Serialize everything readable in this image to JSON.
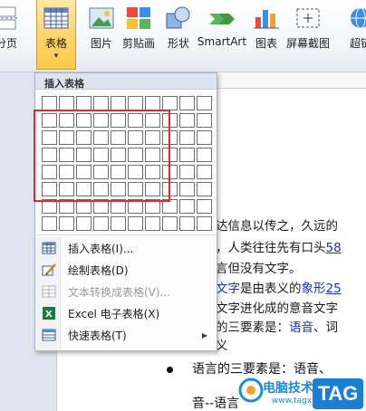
{
  "ribbon": {
    "buttons": {
      "page_break": "分页",
      "table": "表格",
      "picture": "图片",
      "clipart": "剪贴画",
      "shapes": "形状",
      "smartart": "SmartArt",
      "chart": "图表",
      "screenshot": "屏幕截图",
      "hyperlink": "超链"
    },
    "table_arrow": "▾"
  },
  "panel": {
    "header": "插入表格",
    "grid": {
      "columns": 10,
      "rows": 8,
      "selected_columns": 7,
      "selected_rows": 5
    },
    "menu": [
      {
        "label": "插入表格(I)...",
        "icon": "insert-table-icon",
        "enabled": true
      },
      {
        "label": "绘制表格(D)",
        "icon": "draw-table-icon",
        "enabled": true
      },
      {
        "label": "文本转换成表格(V)...",
        "icon": "convert-text-icon",
        "enabled": false
      },
      {
        "label": "Excel 电子表格(X)",
        "icon": "excel-icon",
        "enabled": true
      },
      {
        "label": "快速表格(T)",
        "icon": "quick-table-icon",
        "enabled": true,
        "submenu": true
      }
    ],
    "submenu_arrow": "▶"
  },
  "document": {
    "line1": "达信息以传之，久远的",
    "line2_a": "，人类往往先有口头",
    "line2_b": "58",
    "line3": "言但没有文字。",
    "line4_a": "文字",
    "line4_b": "是由表义的",
    "line4_c": "象形",
    "line4_d": "25",
    "line5": "文字进化成的意音文字",
    "line6_a": "的三要素是：",
    "line6_b": "语音",
    "line6_c": "、词",
    "line7": "义",
    "bullet": "语言的三要素是：语音、",
    "last": "音--语言"
  },
  "watermark": {
    "text": "电脑技术网",
    "url": "www.tagxp.com",
    "tag": "TAG"
  },
  "colors": {
    "selection": "#e8262b",
    "link": "#1535c0",
    "ribbon_active": "#ffd46a"
  }
}
